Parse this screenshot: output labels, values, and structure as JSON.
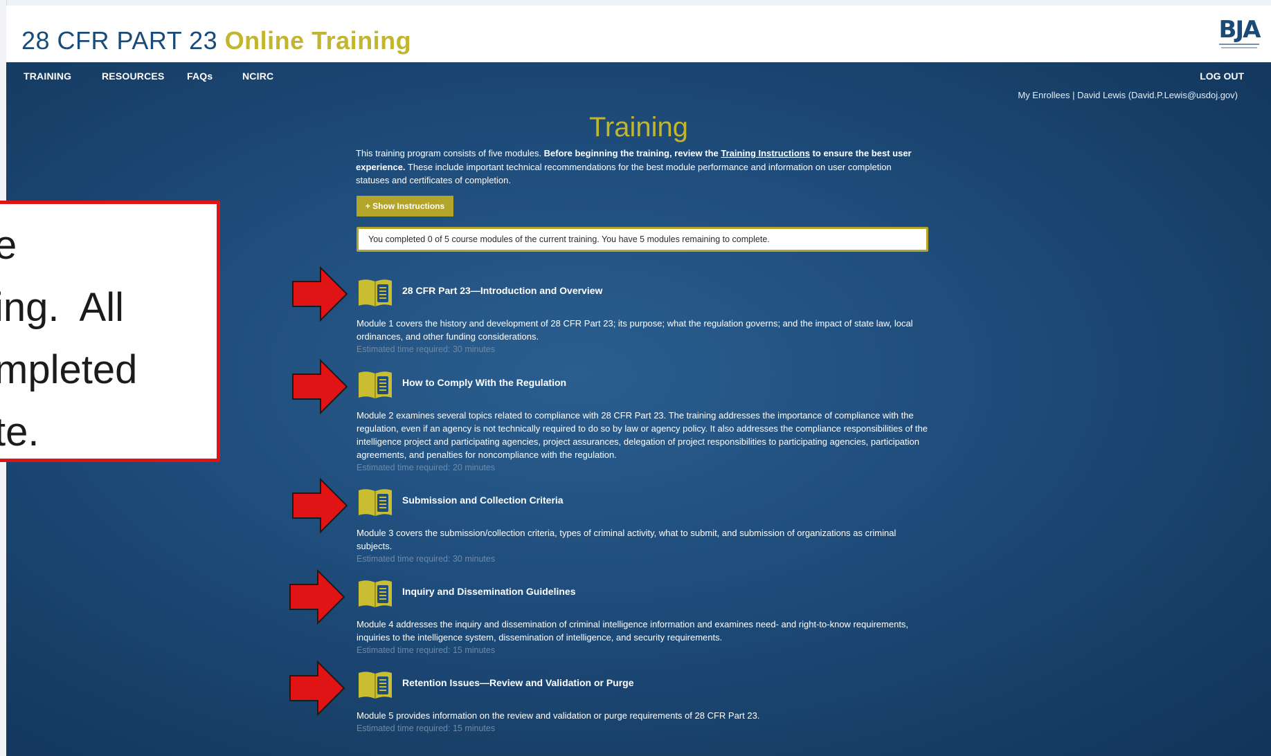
{
  "header": {
    "title_main": "28 CFR PART 23",
    "title_accent": "Online Training",
    "logo_text": "BJA"
  },
  "nav": {
    "items": [
      "TRAINING",
      "RESOURCES",
      "FAQs",
      "NCIRC"
    ],
    "logout": "LOG OUT",
    "user_line": "My Enrollees | David Lewis (David.P.Lewis@usdoj.gov)"
  },
  "page": {
    "title": "Training",
    "intro_part1": "This training program consists of five modules. ",
    "intro_bold1": "Before beginning the training, review the ",
    "intro_link": "Training Instructions",
    "intro_bold2": " to ensure the best user experience.",
    "intro_part2": " These include important technical recommendations for the best module performance and information on user completion statuses and certificates of completion.",
    "show_instructions": "+ Show Instructions",
    "progress_text": "You completed 0 of 5 course modules of the current training. You have 5 modules remaining to complete."
  },
  "modules": [
    {
      "title": "28 CFR Part 23—Introduction and Overview",
      "description": "Module 1 covers the history and development of 28 CFR Part 23; its purpose; what the regulation governs; and the impact of state law, local ordinances, and other funding considerations.",
      "estimate": "Estimated time required: 30 minutes"
    },
    {
      "title": "How to Comply With the Regulation",
      "description": "Module 2 examines several topics related to compliance with 28 CFR Part 23. The training addresses the importance of compliance with the regulation, even if an agency is not technically required to do so by law or agency policy. It also addresses the compliance responsibilities of the intelligence project and participating agencies, project assurances, delegation of project responsibilities to participating agencies, participation agreements, and penalties for noncompliance with the regulation.",
      "estimate": "Estimated time required: 20 minutes"
    },
    {
      "title": "Submission and Collection Criteria",
      "description": "Module 3 covers the submission/collection criteria, types of criminal activity, what to submit, and submission of organizations as criminal subjects.",
      "estimate": "Estimated time required: 30 minutes"
    },
    {
      "title": "Inquiry and Dissemination Guidelines",
      "description": "Module 4 addresses the inquiry and dissemination of criminal intelligence information and examines need- and right-to-know requirements, inquiries to the intelligence system, dissemination of intelligence, and security requirements.",
      "estimate": "Estimated time required: 15 minutes"
    },
    {
      "title": "Retention Issues—Review and Validation or Purge",
      "description": "Module 5 provides information on the review and validation or purge requirements of 28 CFR Part 23.",
      "estimate": "Estimated time required: 15 minutes"
    }
  ],
  "callout": {
    "lines": [
      "e",
      "ing.  All",
      "mpleted",
      "te."
    ]
  },
  "colors": {
    "accent": "#c2b62e",
    "button": "#b3a52a",
    "background": "#1f4d7c",
    "arrow": "#e01414"
  }
}
